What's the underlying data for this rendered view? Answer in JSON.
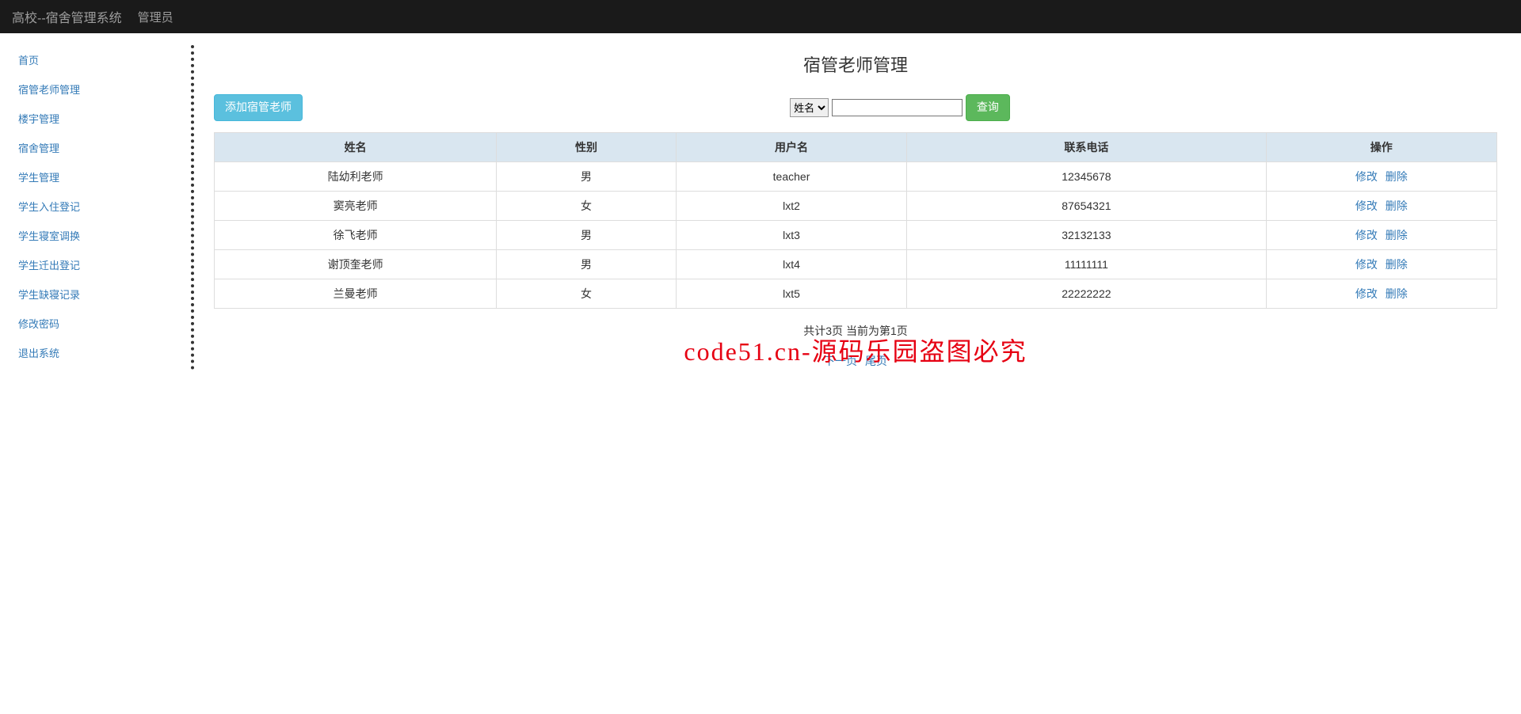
{
  "navbar": {
    "brand": "高校--宿舍管理系统",
    "role": "管理员"
  },
  "sidebar": {
    "items": [
      {
        "label": "首页"
      },
      {
        "label": "宿管老师管理"
      },
      {
        "label": "楼宇管理"
      },
      {
        "label": "宿舍管理"
      },
      {
        "label": "学生管理"
      },
      {
        "label": "学生入住登记"
      },
      {
        "label": "学生寝室调换"
      },
      {
        "label": "学生迁出登记"
      },
      {
        "label": "学生缺寝记录"
      },
      {
        "label": "修改密码"
      },
      {
        "label": "退出系统"
      }
    ]
  },
  "page": {
    "title": "宿管老师管理"
  },
  "toolbar": {
    "add_label": "添加宿管老师",
    "search_field_selected": "姓名",
    "search_value": "",
    "search_button": "查询"
  },
  "table": {
    "headers": [
      "姓名",
      "性别",
      "用户名",
      "联系电话",
      "操作"
    ],
    "rows": [
      {
        "name": "陆幼利老师",
        "gender": "男",
        "username": "teacher",
        "phone": "12345678"
      },
      {
        "name": "窦亮老师",
        "gender": "女",
        "username": "lxt2",
        "phone": "87654321"
      },
      {
        "name": "徐飞老师",
        "gender": "男",
        "username": "lxt3",
        "phone": "32132133"
      },
      {
        "name": "谢顶奎老师",
        "gender": "男",
        "username": "lxt4",
        "phone": "11111111"
      },
      {
        "name": "兰曼老师",
        "gender": "女",
        "username": "lxt5",
        "phone": "22222222"
      }
    ],
    "action_edit": "修改",
    "action_delete": "删除"
  },
  "pagination": {
    "info": "共计3页 当前为第1页",
    "next": "下一页",
    "last": "尾页"
  },
  "watermark": "code51.cn-源码乐园盗图必究"
}
